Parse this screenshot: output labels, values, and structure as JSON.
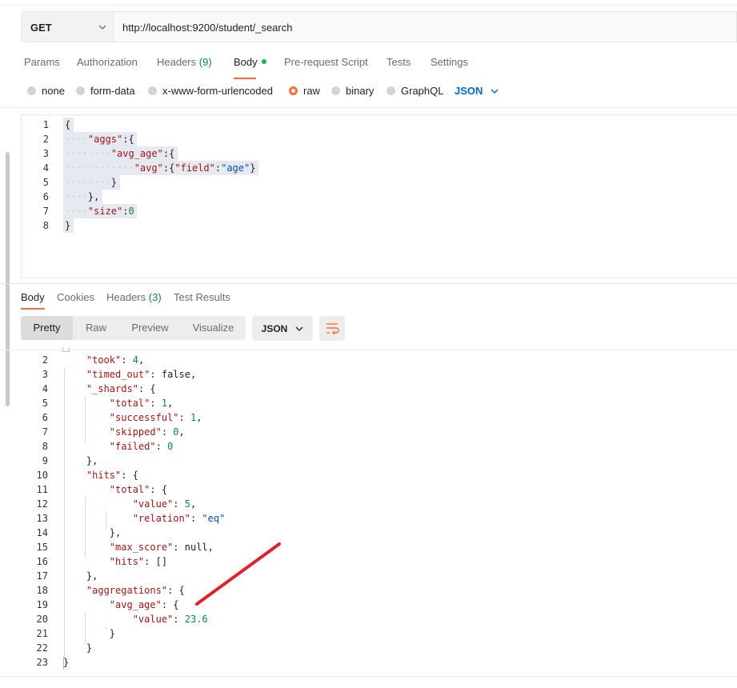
{
  "request": {
    "method": "GET",
    "url": "http://localhost:9200/student/_search",
    "tabs": [
      {
        "label": "Params"
      },
      {
        "label": "Authorization"
      },
      {
        "label": "Headers",
        "count": "(9)"
      },
      {
        "label": "Body",
        "active": true
      },
      {
        "label": "Pre-request Script"
      },
      {
        "label": "Tests"
      },
      {
        "label": "Settings"
      }
    ],
    "body_types": [
      {
        "label": "none"
      },
      {
        "label": "form-data"
      },
      {
        "label": "x-www-form-urlencoded"
      },
      {
        "label": "raw",
        "selected": true
      },
      {
        "label": "binary"
      },
      {
        "label": "GraphQL"
      }
    ],
    "language": "JSON"
  },
  "editor": {
    "line_numbers": [
      "1",
      "2",
      "3",
      "4",
      "5",
      "6",
      "7",
      "8"
    ],
    "lines": [
      "{",
      "····\"aggs\":{",
      "········\"avg_age\":{",
      "············\"avg\":{\"field\":\"age\"}",
      "········}",
      "····},",
      "····\"size\":0",
      "}"
    ]
  },
  "response": {
    "tabs": [
      {
        "label": "Body",
        "active": true
      },
      {
        "label": "Cookies"
      },
      {
        "label": "Headers",
        "count": "(3)"
      },
      {
        "label": "Test Results"
      }
    ],
    "views": [
      "Pretty",
      "Raw",
      "Preview",
      "Visualize"
    ],
    "active_view": "Pretty",
    "format": "JSON",
    "line_numbers": [
      "2",
      "3",
      "4",
      "5",
      "6",
      "7",
      "8",
      "9",
      "10",
      "11",
      "12",
      "13",
      "14",
      "15",
      "16",
      "17",
      "18",
      "19",
      "20",
      "21",
      "22",
      "23"
    ],
    "lines": [
      "    \"took\": 4,",
      "    \"timed_out\": false,",
      "    \"_shards\": {",
      "        \"total\": 1,",
      "        \"successful\": 1,",
      "        \"skipped\": 0,",
      "        \"failed\": 0",
      "    },",
      "    \"hits\": {",
      "        \"total\": {",
      "            \"value\": 5,",
      "            \"relation\": \"eq\"",
      "        },",
      "        \"max_score\": null,",
      "        \"hits\": []",
      "    },",
      "    \"aggregations\": {",
      "        \"avg_age\": {",
      "            \"value\": 23.6",
      "        }",
      "    }",
      "}"
    ]
  },
  "colors": {
    "accent": "#ff6c37",
    "link": "#0265d2",
    "annotation": "#e0212b",
    "status_green": "#0cbb52"
  },
  "icons": {
    "method_dropdown": "chevron-down-icon",
    "language_dropdown": "chevron-down-icon",
    "wrap": "wrap-lines-icon"
  }
}
